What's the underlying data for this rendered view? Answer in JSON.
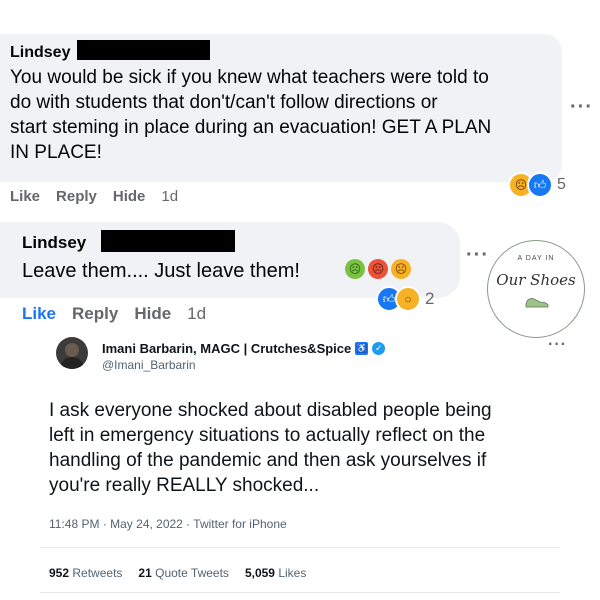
{
  "comment1": {
    "name": "Lindsey",
    "lines": [
      "You would be sick if you knew what teachers were told to",
      "do with students that don't/can't follow directions or",
      "start steming in place during an evacuation! GET A PLAN",
      "IN PLACE!"
    ],
    "actions": {
      "like": "Like",
      "reply": "Reply",
      "hide": "Hide",
      "time": "1d"
    },
    "reactions": {
      "icons": [
        "sad-emoji",
        "like-emoji"
      ],
      "count": "5"
    },
    "more": "···"
  },
  "comment2": {
    "name": "Lindsey",
    "text": "Leave them.... Just leave them!",
    "emojis": [
      "sick-face-emoji",
      "angry-face-emoji",
      "crying-face-emoji"
    ],
    "actions": {
      "like": "Like",
      "reply": "Reply",
      "hide": "Hide",
      "time": "1d"
    },
    "reactions": {
      "icons": [
        "like-emoji",
        "wow-emoji"
      ],
      "count": "2"
    },
    "more": "···"
  },
  "logo": {
    "top": "A DAY IN",
    "main": "Our Shoes"
  },
  "tweet": {
    "name": "Imani Barbarin, MAGC | Crutches&Spice",
    "handle": "@Imani_Barbarin",
    "lines": [
      "I ask everyone shocked about disabled people being",
      "left in emergency situations to actually reflect on the",
      "handling of the pandemic and then ask yourselves if",
      "you're really REALLY shocked..."
    ],
    "meta": "11:48 PM · May 24, 2022 · Twitter for iPhone",
    "retweets": {
      "count": "952",
      "label": "Retweets"
    },
    "quotes": {
      "count": "21",
      "label": "Quote Tweets"
    },
    "likes": {
      "count": "5,059",
      "label": "Likes"
    },
    "more": "···"
  },
  "colors": {
    "fb_blue": "#1877f2",
    "twitter_blue": "#1d9bf0",
    "bubble": "#f0f2f5"
  }
}
